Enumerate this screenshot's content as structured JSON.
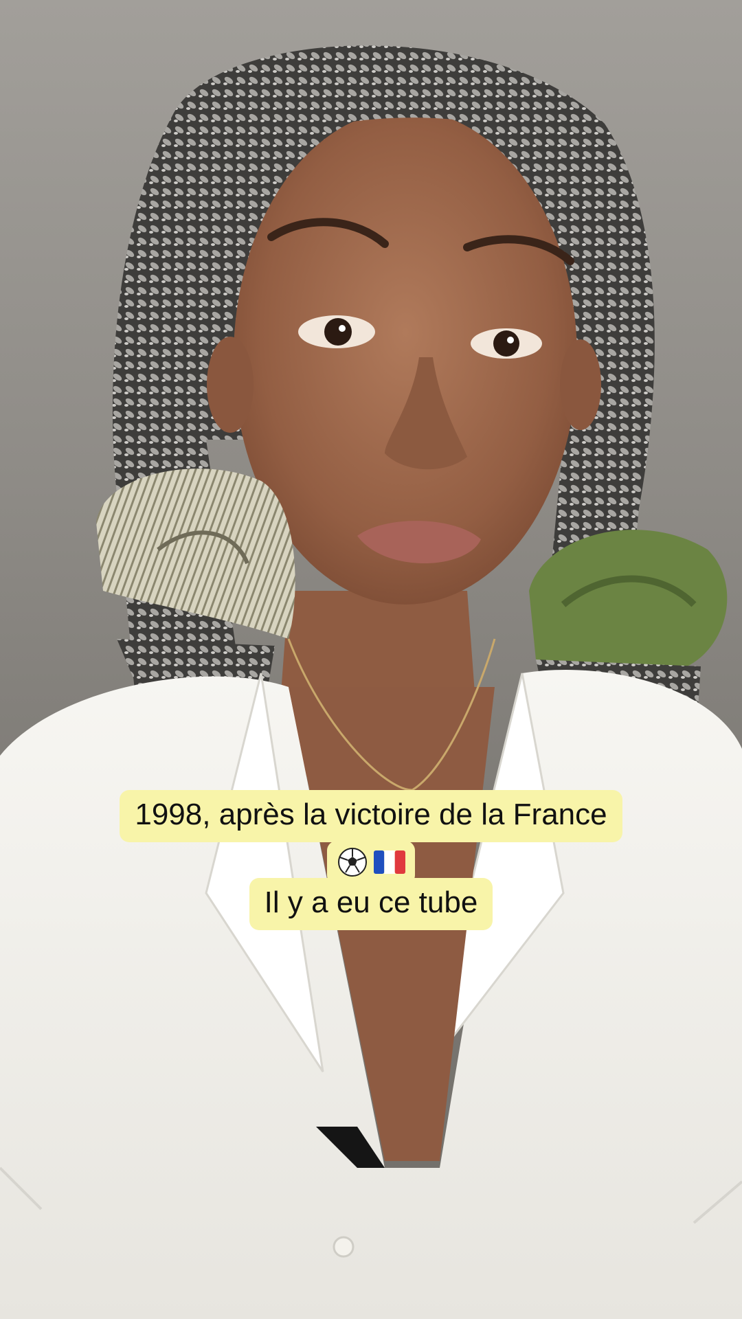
{
  "video": {
    "overlay_text": {
      "line1": "1998, après la victoire de la France",
      "line2_icons": [
        "soccer-ball-emoji",
        "france-flag-emoji"
      ],
      "line3": "Il y a eu ce tube"
    }
  },
  "colors": {
    "caption_bg": "#f8f4a9",
    "caption_text": "#111111",
    "shirt": "#f1f0ec",
    "skin": "#a36f52",
    "background_wall": "#8f8c87"
  }
}
